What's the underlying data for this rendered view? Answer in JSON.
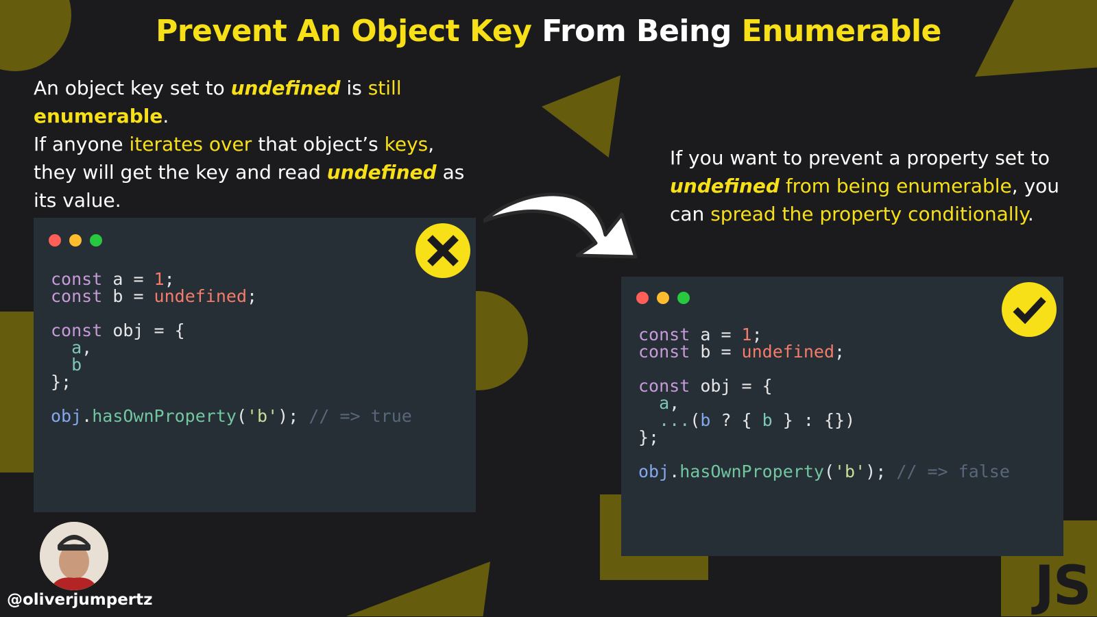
{
  "title": {
    "part1": "Prevent An Object Key",
    "part2": "From Being",
    "part3": "Enumerable"
  },
  "intro": {
    "line1_a": "An object key set to",
    "line1_b": "undefined",
    "line1_c": "is",
    "line1_d": "still",
    "line1_e": "enumerable",
    "line1_f": ".",
    "line2_a": "If anyone",
    "line2_b": "iterates over",
    "line2_c": "that object’s",
    "line2_d": "keys",
    "line2_e": ", they will get the key and read",
    "line2_f": "undefined",
    "line2_g": "as its value."
  },
  "solution": {
    "a": "If you want to prevent a property set to",
    "b": "undefined",
    "c": "from being enumerable",
    "d": ",",
    "e": "you can",
    "f": "spread the property conditionally",
    "g": "."
  },
  "code_bad": {
    "status": "wrong",
    "kw": "const",
    "a_name": "a",
    "a_val": "1",
    "b_name": "b",
    "b_val": "undefined",
    "obj_name": "obj",
    "prop_a": "a",
    "prop_b": "b",
    "call_obj": "obj",
    "call_fn": "hasOwnProperty",
    "call_arg": "'b'",
    "comment": "// => true"
  },
  "code_good": {
    "status": "correct",
    "kw": "const",
    "a_name": "a",
    "a_val": "1",
    "b_name": "b",
    "b_val": "undefined",
    "obj_name": "obj",
    "prop_a": "a",
    "spread_cond": "b",
    "spread_key": "b",
    "call_obj": "obj",
    "call_fn": "hasOwnProperty",
    "call_arg": "'b'",
    "comment": "// => false"
  },
  "author": "@oliverjumpertz",
  "logo": "JS",
  "colors": {
    "background": "#1b1b1d",
    "accent": "#f7e017",
    "decor": "#655c0e",
    "code_bg": "#262e36"
  }
}
